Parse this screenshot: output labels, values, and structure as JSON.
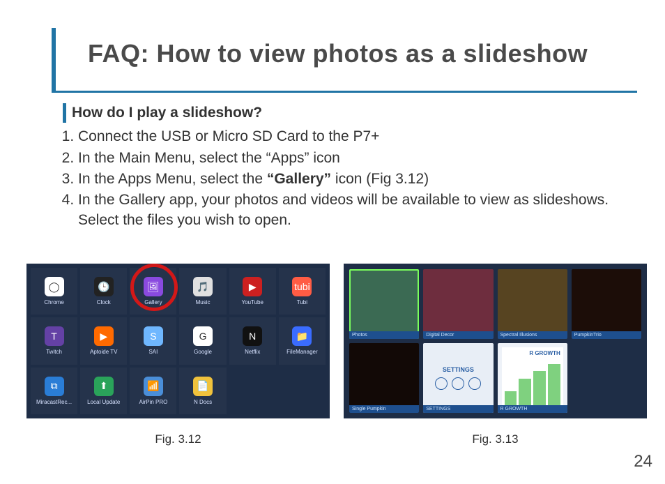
{
  "page_number": "24",
  "title": "FAQ: How to view photos as a slideshow",
  "question": "How do I play a slideshow?",
  "steps": [
    "Connect the USB or Micro SD Card to the P7+",
    "In the Main Menu, select the “Apps” icon",
    {
      "pre": "In the Apps Menu, select the ",
      "bold": "“Gallery”",
      "post": " icon (Fig 3.12)"
    },
    "In the Gallery app, your photos and videos will be available to view as slideshows. Select the files you wish to open."
  ],
  "fig_left": {
    "caption": "Fig. 3.12",
    "circled_app": "Gallery",
    "apps": [
      {
        "label": "Chrome",
        "bg": "#ffffff",
        "glyph": "◯"
      },
      {
        "label": "Clock",
        "bg": "#222",
        "glyph": "🕒"
      },
      {
        "label": "Gallery",
        "bg": "#8a4adf",
        "glyph": "🖼"
      },
      {
        "label": "Music",
        "bg": "#e0e0e0",
        "glyph": "🎵"
      },
      {
        "label": "YouTube",
        "bg": "#cc2020",
        "glyph": "▶"
      },
      {
        "label": "Tubi",
        "bg": "#ff5c44",
        "glyph": "tubi"
      },
      {
        "label": "Twitch",
        "bg": "#6441a5",
        "glyph": "T"
      },
      {
        "label": "Aptoide TV",
        "bg": "#ff6a00",
        "glyph": "▶"
      },
      {
        "label": "SAI",
        "bg": "#6fb7ff",
        "glyph": "S"
      },
      {
        "label": "Google",
        "bg": "#ffffff",
        "glyph": "G"
      },
      {
        "label": "Netflix",
        "bg": "#111",
        "glyph": "N"
      },
      {
        "label": "FileManager",
        "bg": "#3a6cff",
        "glyph": "📁"
      },
      {
        "label": "MiracastRec...",
        "bg": "#2a7dd6",
        "glyph": "⧉"
      },
      {
        "label": "Local Update",
        "bg": "#2aa35a",
        "glyph": "⬆"
      },
      {
        "label": "AirPin PRO",
        "bg": "#4a8ed8",
        "glyph": "📶"
      },
      {
        "label": "N Docs",
        "bg": "#f0c23c",
        "glyph": "📄"
      }
    ]
  },
  "fig_right": {
    "caption": "Fig. 3.13",
    "thumbs": [
      {
        "label": "Photos",
        "selected": true,
        "bg": "#3b6a53"
      },
      {
        "label": "Digital Decor",
        "bg": "#6e2d3e"
      },
      {
        "label": "Spectral Illusions",
        "bg": "#574421"
      },
      {
        "label": "PumpkinTrio",
        "bg": "#1c0d08"
      },
      {
        "label": "Single Pumpkin",
        "bg": "#120906"
      },
      {
        "label": "SETTINGS",
        "bg": "#e8eef6",
        "extra": "settings"
      },
      {
        "label": "R GROWTH",
        "bg": "#eef2f8",
        "extra": "chart"
      },
      {
        "label": "",
        "bg": "#263347",
        "hidden": true
      }
    ]
  }
}
